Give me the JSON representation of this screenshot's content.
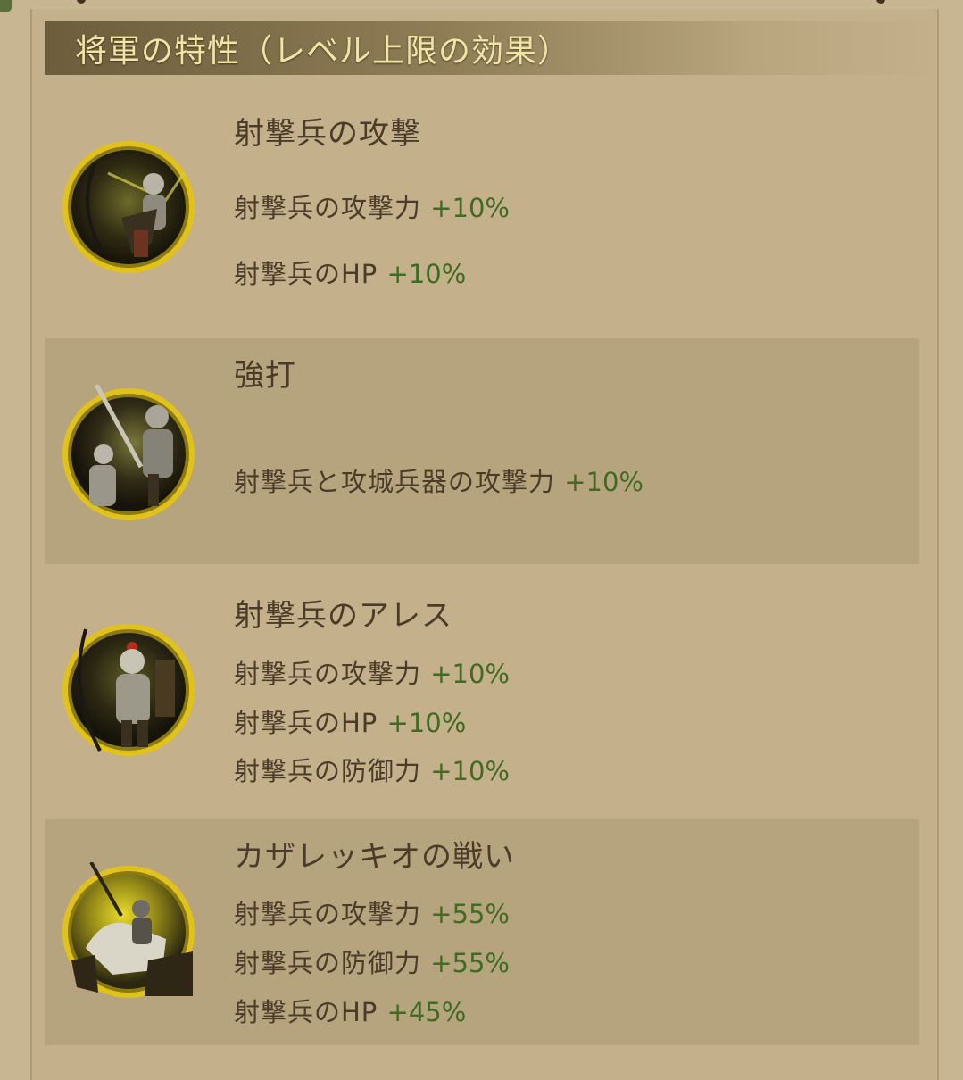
{
  "header": {
    "title": "将軍の特性（レベル上限の効果）"
  },
  "colors": {
    "bonus_green": "#3f6c22",
    "text_brown": "#4a3c28",
    "gold_ring": "#e0c21a",
    "title_gold": "#f3e4a6"
  },
  "skills": [
    {
      "title": "射撃兵の攻撃",
      "icon": "archer-icon",
      "stats": [
        {
          "label": "射撃兵の攻撃力",
          "value": "+10%"
        },
        {
          "label": "射撃兵のHP",
          "value": "+10%"
        }
      ]
    },
    {
      "title": "強打",
      "icon": "knight-sword-icon",
      "stats": [
        {
          "label": "射撃兵と攻城兵器の攻撃力",
          "value": "+10%"
        }
      ]
    },
    {
      "title": "射撃兵のアレス",
      "icon": "armored-archer-icon",
      "stats": [
        {
          "label": "射撃兵の攻撃力",
          "value": "+10%"
        },
        {
          "label": "射撃兵のHP",
          "value": "+10%"
        },
        {
          "label": "射撃兵の防御力",
          "value": "+10%"
        }
      ]
    },
    {
      "title": "カザレッキオの戦い",
      "icon": "cavalry-battle-icon",
      "stats": [
        {
          "label": "射撃兵の攻撃力",
          "value": "+55%"
        },
        {
          "label": "射撃兵の防御力",
          "value": "+55%"
        },
        {
          "label": "射撃兵のHP",
          "value": "+45%"
        }
      ]
    }
  ]
}
